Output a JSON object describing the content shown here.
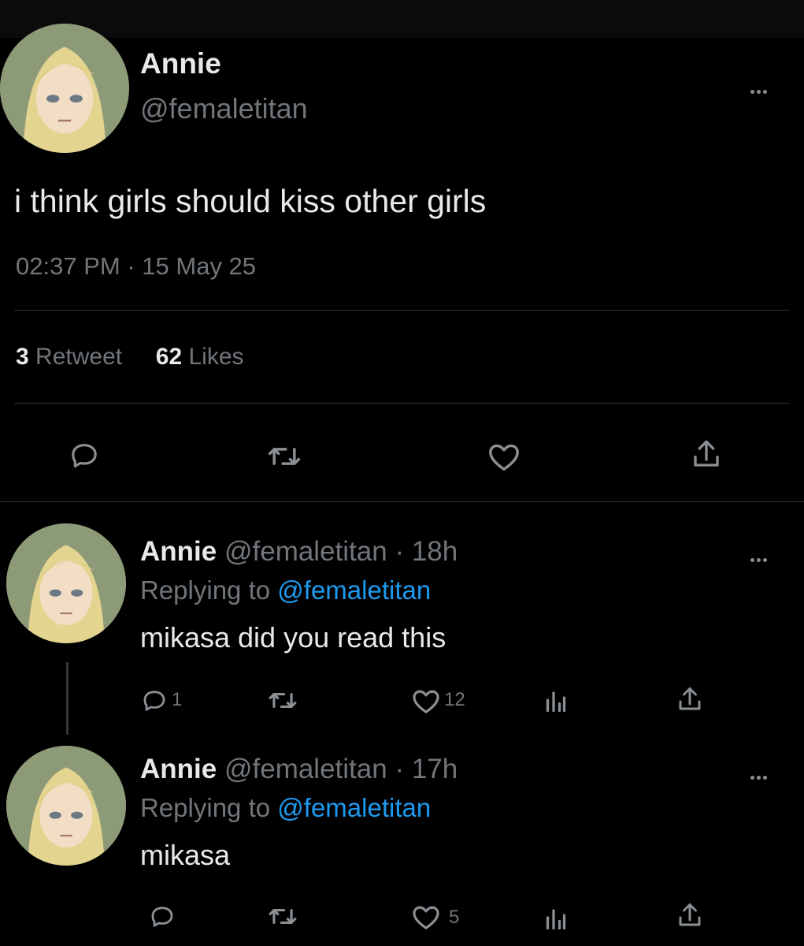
{
  "main_tweet": {
    "display_name": "Annie",
    "handle": "@femaletitan",
    "text": "i think girls should kiss other girls",
    "time": "02:37 PM",
    "separator": "·",
    "date": "15 May 25",
    "retweet_count": "3",
    "retweet_label": "Retweet",
    "likes_count": "62",
    "likes_label": "Likes"
  },
  "replies": [
    {
      "display_name": "Annie",
      "handle": "@femaletitan",
      "age": "· 18h",
      "replying_label": "Replying to",
      "replying_handle": "@femaletitan",
      "text": "mikasa did you read this",
      "reply_count": "1",
      "like_count": "12"
    },
    {
      "display_name": "Annie",
      "handle": "@femaletitan",
      "age": "· 17h",
      "replying_label": "Replying to",
      "replying_handle": "@femaletitan",
      "text": "mikasa",
      "reply_count": "",
      "like_count": "5"
    }
  ],
  "icons": {
    "reply": "reply-icon",
    "retweet": "retweet-icon",
    "like": "heart-icon",
    "share": "share-icon",
    "views": "views-icon",
    "more": "more-icon"
  },
  "colors": {
    "background": "#000000",
    "text": "#e7e9ea",
    "secondary": "#71767b",
    "link": "#1d9bf0"
  }
}
